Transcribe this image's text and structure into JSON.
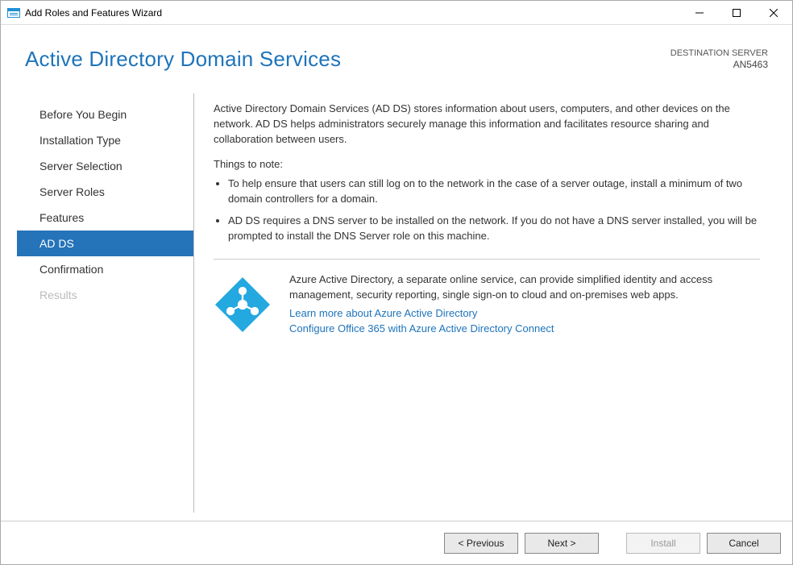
{
  "window": {
    "title": "Add Roles and Features Wizard"
  },
  "header": {
    "page_title": "Active Directory Domain Services",
    "destination_label": "DESTINATION SERVER",
    "destination_name": "AN5463"
  },
  "sidebar": {
    "items": [
      {
        "label": "Before You Begin",
        "state": "normal"
      },
      {
        "label": "Installation Type",
        "state": "normal"
      },
      {
        "label": "Server Selection",
        "state": "normal"
      },
      {
        "label": "Server Roles",
        "state": "normal"
      },
      {
        "label": "Features",
        "state": "normal"
      },
      {
        "label": "AD DS",
        "state": "selected"
      },
      {
        "label": "Confirmation",
        "state": "normal"
      },
      {
        "label": "Results",
        "state": "disabled"
      }
    ]
  },
  "content": {
    "intro": "Active Directory Domain Services (AD DS) stores information about users, computers, and other devices on the network.  AD DS helps administrators securely manage this information and facilitates resource sharing and collaboration between users.",
    "note_heading": "Things to note:",
    "notes": [
      "To help ensure that users can still log on to the network in the case of a server outage, install a minimum of two domain controllers for a domain.",
      "AD DS requires a DNS server to be installed on the network.  If you do not have a DNS server installed, you will be prompted to install the DNS Server role on this machine."
    ],
    "info": {
      "text": "Azure Active Directory, a separate online service, can provide simplified identity and access management, security reporting, single sign-on to cloud and on-premises web apps.",
      "link1": "Learn more about Azure Active Directory",
      "link2": "Configure Office 365 with Azure Active Directory Connect"
    }
  },
  "footer": {
    "previous": "< Previous",
    "next": "Next >",
    "install": "Install",
    "cancel": "Cancel"
  }
}
